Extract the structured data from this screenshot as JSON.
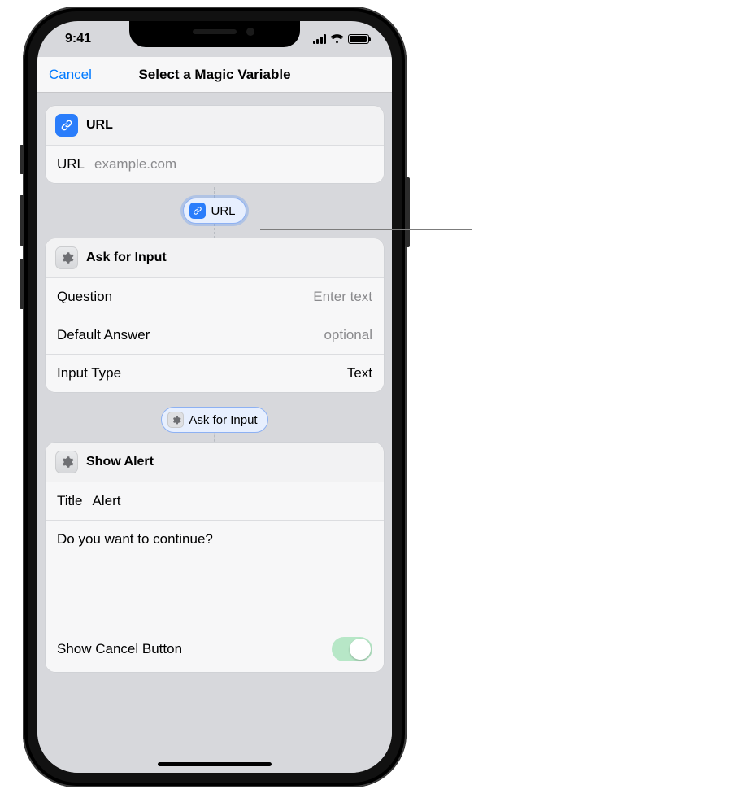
{
  "status": {
    "time": "9:41"
  },
  "navbar": {
    "cancel": "Cancel",
    "title": "Select a Magic Variable"
  },
  "card_url": {
    "title": "URL",
    "field_label": "URL",
    "placeholder": "example.com"
  },
  "pill_url": {
    "label": "URL"
  },
  "card_ask": {
    "title": "Ask for Input",
    "question_label": "Question",
    "question_placeholder": "Enter text",
    "default_answer_label": "Default Answer",
    "default_answer_placeholder": "optional",
    "input_type_label": "Input Type",
    "input_type_value": "Text"
  },
  "pill_ask": {
    "label": "Ask for Input"
  },
  "card_alert": {
    "title": "Show Alert",
    "title_field_label": "Title",
    "title_field_value": "Alert",
    "message": "Do you want to continue?",
    "show_cancel_label": "Show Cancel Button",
    "show_cancel_value": true
  }
}
